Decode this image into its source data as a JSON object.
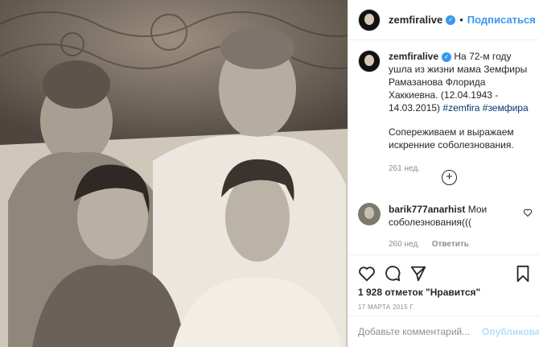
{
  "post": {
    "username": "zemfiralive",
    "follow_label": "Подписаться",
    "separator": "•",
    "verified_icon": "check-icon"
  },
  "caption": {
    "username": "zemfiralive",
    "text_line1": "На 72-м году ушла из жизни мама Земфиры Рамазанова Флорида Хаккиевна.",
    "dates": "(12.04.1943 - 14.03.2015)",
    "tag1": "#zemfira",
    "tag2": "#земфира",
    "text_line2": "Сопереживаем и выражаем искренние соболезнования.",
    "time": "261 нед."
  },
  "comment": {
    "username": "barik777anarhist",
    "text": "Мои соболезнования(((",
    "time": "260 нед.",
    "reply_label": "Ответить"
  },
  "likes": "1 928 отметок \"Нравится\"",
  "date": "17 МАРТА 2015 Г.",
  "comment_box": {
    "placeholder": "Добавьте комментарий...",
    "publish_label": "Опубликовать"
  },
  "colors": {
    "accent": "#3897f0",
    "muted": "#8e8e8e",
    "publish_disabled": "#b2dffc"
  }
}
